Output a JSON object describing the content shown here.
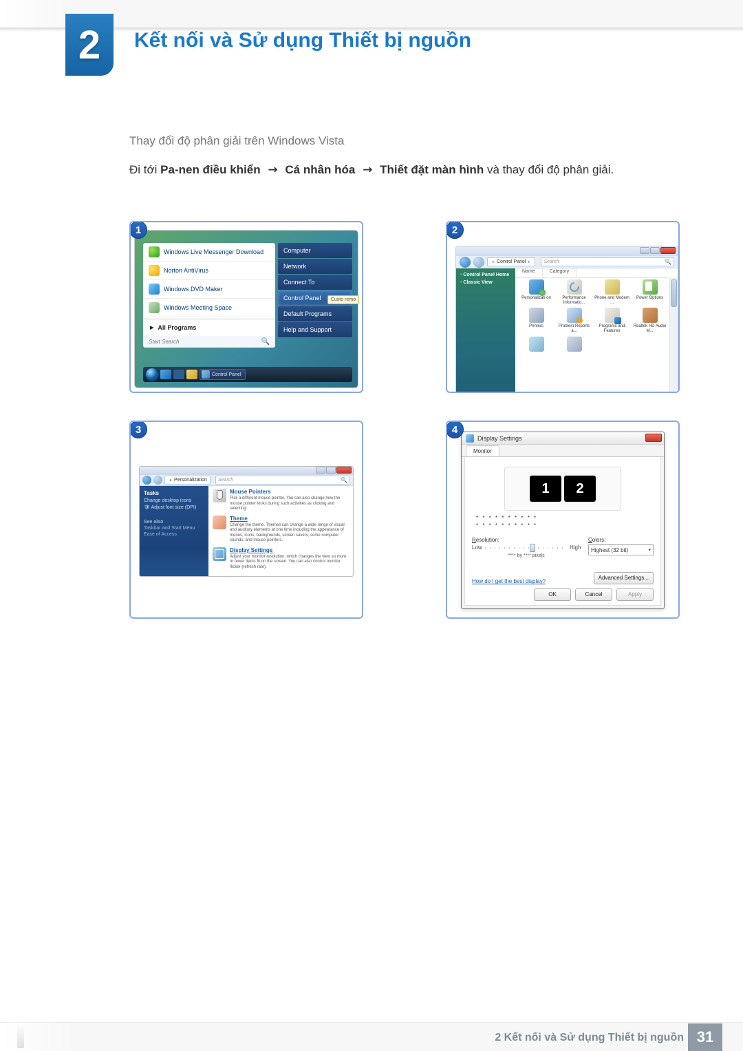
{
  "chapter": {
    "number": "2",
    "title": "Kết nối và Sử dụng Thiết bị nguồn"
  },
  "section": {
    "subhead": "Thay đổi độ phân giải trên Windows Vista",
    "instr_prefix": "Đi tới ",
    "path": [
      "Pa-nen điều khiển",
      "Cá nhân hóa",
      "Thiết đặt màn hình"
    ],
    "instr_suffix": " và thay đổi độ phân giải.",
    "arrow": "→"
  },
  "shot1": {
    "badge": "1",
    "left_items": [
      "Windows Live Messenger Download",
      "Norton AntiVirus",
      "Windows DVD Maker",
      "Windows Meeting Space"
    ],
    "all_programs": "All Programs",
    "search_placeholder": "Start Search",
    "right_items": [
      "Computer",
      "Network",
      "Connect To",
      "Control Panel",
      "Default Programs",
      "Help and Support"
    ],
    "tooltip": "Custo\nremo",
    "taskbar_label": "Control Panel"
  },
  "shot2": {
    "badge": "2",
    "breadcrumb": [
      "Control Panel"
    ],
    "search_placeholder": "Search",
    "side_links": [
      "Control Panel Home",
      "Classic View"
    ],
    "columns": [
      "Name",
      "Category"
    ],
    "items": [
      "Personalizati on",
      "Performance Informatio...",
      "Phone and Modem ...",
      "Power Options",
      "Printers",
      "Problem Reports a...",
      "Programs and Features",
      "Realtek HD Audio M..."
    ]
  },
  "shot3": {
    "badge": "3",
    "breadcrumb": [
      "Personalization"
    ],
    "search_placeholder": "Search",
    "side_heading1": "Tasks",
    "side_links1": [
      "Change desktop icons",
      "Adjust font size (DPI)"
    ],
    "side_heading2": "See also",
    "side_links2": [
      "Taskbar and Start Menu",
      "Ease of Access"
    ],
    "sec_mouse_title": "Mouse Pointers",
    "sec_mouse_text": "Pick a different mouse pointer. You can also change how the mouse pointer looks during such activities as clicking and selecting.",
    "sec_theme_title": "Theme",
    "sec_theme_text": "Change the theme. Themes can change a wide range of visual and auditory elements at one time including the appearance of menus, icons, backgrounds, screen savers, some computer sounds, and mouse pointers.",
    "sec_disp_title": "Display Settings",
    "sec_disp_text": "Adjust your monitor resolution, which changes the view so more or fewer items fit on the screen. You can also control monitor flicker (refresh rate)."
  },
  "shot4": {
    "badge": "4",
    "dlg_title": "Display Settings",
    "tab": "Monitor",
    "monitors": [
      "1",
      "2"
    ],
    "stars": "* * * * * * * * * *",
    "res_label": "Resolution:",
    "res_low": "Low",
    "res_high": "High",
    "res_text": "**** by **** pixels",
    "col_label": "Colors:",
    "col_value": "Highest (32 bit)",
    "best_link": "How do I get the best display?",
    "advanced": "Advanced Settings...",
    "ok": "OK",
    "cancel": "Cancel",
    "apply": "Apply"
  },
  "footer": {
    "label": "2 Kết nối và Sử dụng Thiết bị nguồn",
    "page": "31"
  }
}
